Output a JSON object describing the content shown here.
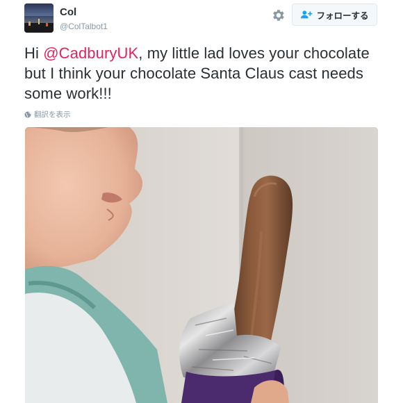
{
  "user": {
    "name": "Col",
    "handle": "@ColTalbot1"
  },
  "header": {
    "settings_icon": "gear-icon",
    "follow_icon": "add-user-icon",
    "follow_label": "フォローする"
  },
  "tweet": {
    "text_prefix": "Hi ",
    "mention": "@CadburyUK",
    "text_suffix": ", my little lad loves your chocolate but I think your chocolate Santa Claus cast needs some work!!!",
    "translate_label": "翻訳を表示",
    "translate_icon": "globe-icon"
  },
  "colors": {
    "mention": "#e0245e",
    "text": "#292f33",
    "secondary": "#8899a6"
  }
}
